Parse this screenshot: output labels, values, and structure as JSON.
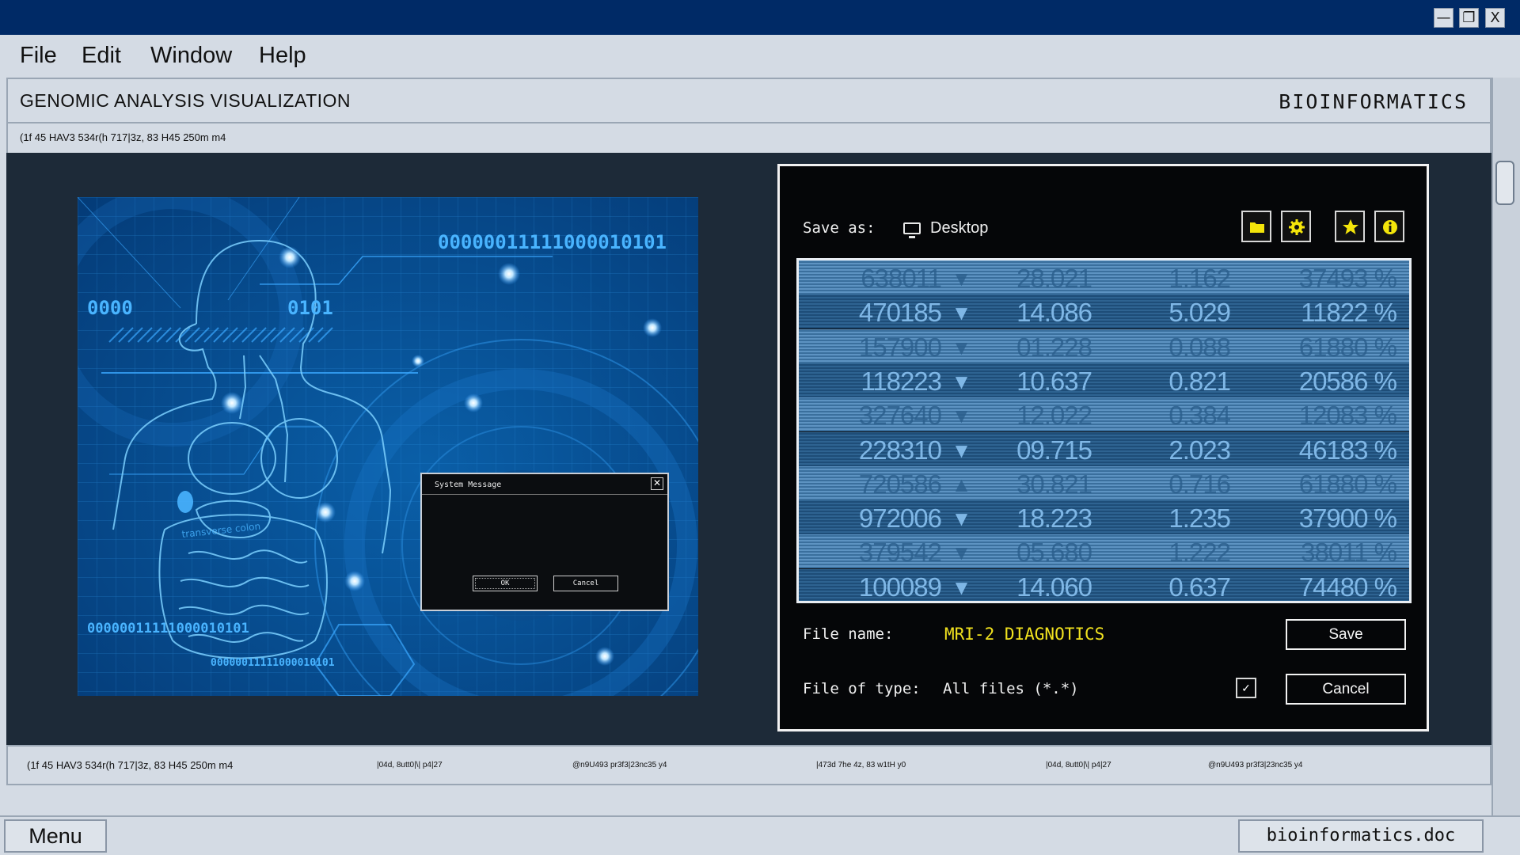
{
  "window_controls": {
    "minimize": "—",
    "maximize": "❐",
    "close": "X"
  },
  "menubar": {
    "items": [
      "File",
      "Edit",
      "Window",
      "Help"
    ]
  },
  "header": {
    "title": "GENOMIC ANALYSIS VISUALIZATION",
    "brand": "BIOINFORMATICS"
  },
  "subline": "(1f 45 HAV3 534r(h 717|3z, 83 H45 250m m4",
  "visual": {
    "binary_top": "00000011111000010101",
    "binary_left": "0000",
    "binary_mid": "0101",
    "binary_bottom": "00000011111000010101",
    "binary_bottom_small": "00000011111000010101",
    "organ_label": "transverse colon"
  },
  "system_message": {
    "title": "System Message",
    "close": "✕",
    "ok": "OK",
    "cancel": "Cancel"
  },
  "save_dialog": {
    "save_as_label": "Save as:",
    "location": "Desktop",
    "toolbar": [
      "folder-icon",
      "gear-icon",
      "star-icon",
      "info-icon"
    ],
    "rows": [
      [
        "638011",
        "▼",
        "28.021",
        "1.162",
        "37493 %"
      ],
      [
        "470185",
        "▼",
        "14.086",
        "5.029",
        "11822 %"
      ],
      [
        "157900",
        "▼",
        "01.228",
        "0.088",
        "61880 %"
      ],
      [
        "118223",
        "▼",
        "10.637",
        "0.821",
        "20586 %"
      ],
      [
        "327640",
        "▼",
        "12.022",
        "0.384",
        "12083 %"
      ],
      [
        "228310",
        "▼",
        "09.715",
        "2.023",
        "46183 %"
      ],
      [
        "720586",
        "▲",
        "30.821",
        "0.716",
        "61880 %"
      ],
      [
        "972006",
        "▼",
        "18.223",
        "1.235",
        "37900 %"
      ],
      [
        "379542",
        "▼",
        "05.680",
        "1.222",
        "38011 %"
      ],
      [
        "100089",
        "▼",
        "14.060",
        "0.637",
        "74480 %"
      ]
    ],
    "file_name_label": "File name:",
    "file_name_value": "MRI-2 DIAGNOTICS",
    "file_type_label": "File of type:",
    "file_type_value": "All files (*.*)",
    "checkbox_mark": "✓",
    "save_button": "Save",
    "cancel_button": "Cancel"
  },
  "statusbar": [
    "(1f 45 HAV3 534r(h 717|3z, 83 H45 250m m4",
    "|04d, 8utt0|\\| p4|27",
    "@n9U493 pr3f3|23nc35 y4",
    "|473d 7he 4z, 83 w1tH y0",
    "|04d, 8utt0|\\| p4|27",
    "@n9U493 pr3f3|23nc35 y4"
  ],
  "taskbar": {
    "menu_label": "Menu",
    "document": "bioinformatics.doc"
  },
  "colors": {
    "titlebar": "#002a66",
    "accent_yellow": "#f1e21f",
    "workspace": "#1d2a38"
  }
}
